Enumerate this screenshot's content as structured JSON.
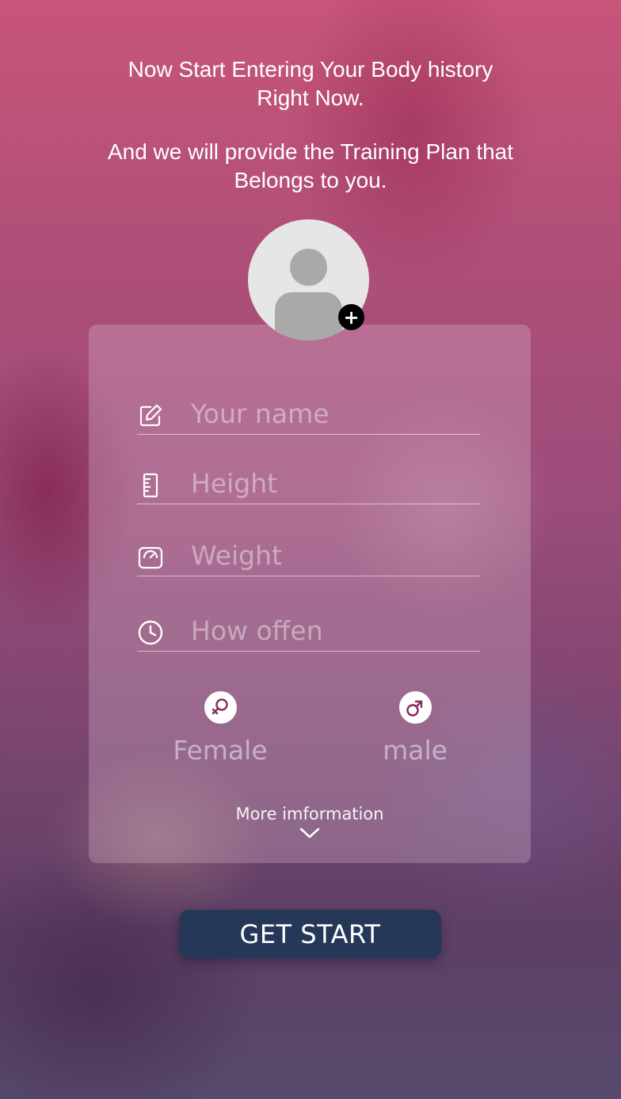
{
  "intro": {
    "line1": "Now Start Entering Your Body history Right Now.",
    "line2": "And we will provide the Training Plan that Belongs to you."
  },
  "profile": {
    "avatar_icon": "person-silhouette-icon",
    "add_icon": "plus-icon",
    "add_symbol": "+"
  },
  "form": {
    "fields": [
      {
        "icon": "edit-icon",
        "placeholder": "Your name",
        "value": ""
      },
      {
        "icon": "ruler-icon",
        "placeholder": "Height",
        "value": ""
      },
      {
        "icon": "scale-icon",
        "placeholder": "Weight",
        "value": ""
      },
      {
        "icon": "clock-icon",
        "placeholder": "How offen",
        "value": ""
      }
    ],
    "gender": {
      "female": {
        "label": "Female",
        "icon": "female-icon"
      },
      "male": {
        "label": "male",
        "icon": "male-icon"
      }
    },
    "more_info": "More imformation",
    "more_icon": "chevron-down-icon"
  },
  "actions": {
    "start_label": "GET START"
  },
  "colors": {
    "button": "#253858",
    "background_top": "#c8557a",
    "background_bottom": "#574a6c"
  }
}
